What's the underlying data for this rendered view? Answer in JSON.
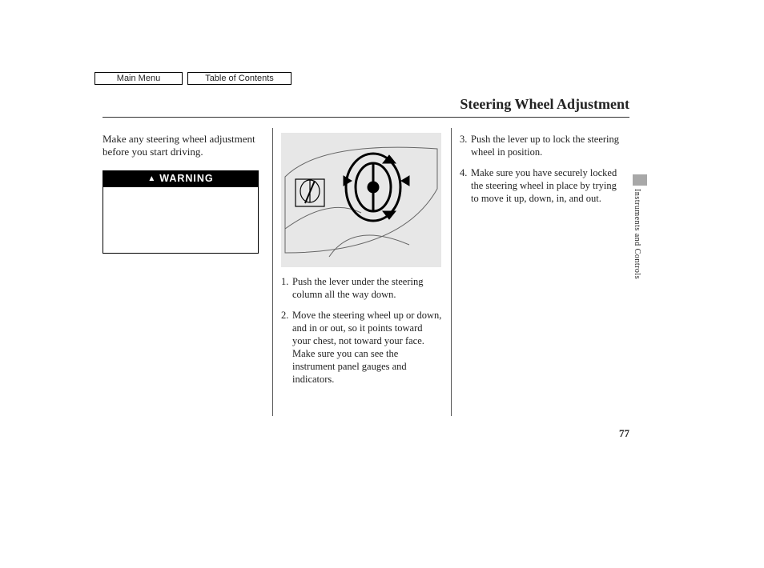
{
  "nav": {
    "main_menu": "Main Menu",
    "toc": "Table of Contents"
  },
  "title": "Steering Wheel Adjustment",
  "intro": "Make any steering wheel adjustment before you start driving.",
  "warning_label": "WARNING",
  "steps": {
    "s1": {
      "n": "1.",
      "t": "Push the lever under the steering column all the way down."
    },
    "s2": {
      "n": "2.",
      "t": "Move the steering wheel up or down, and in or out, so it points toward your chest, not toward your face. Make sure you can see the instrument panel gauges and indicators."
    },
    "s3": {
      "n": "3.",
      "t": "Push the lever up to lock the steering wheel in position."
    },
    "s4": {
      "n": "4.",
      "t": "Make sure you have securely locked the steering wheel in place by trying to move it up, down, in, and out."
    }
  },
  "section_tab": "Instruments and Controls",
  "page_number": "77"
}
